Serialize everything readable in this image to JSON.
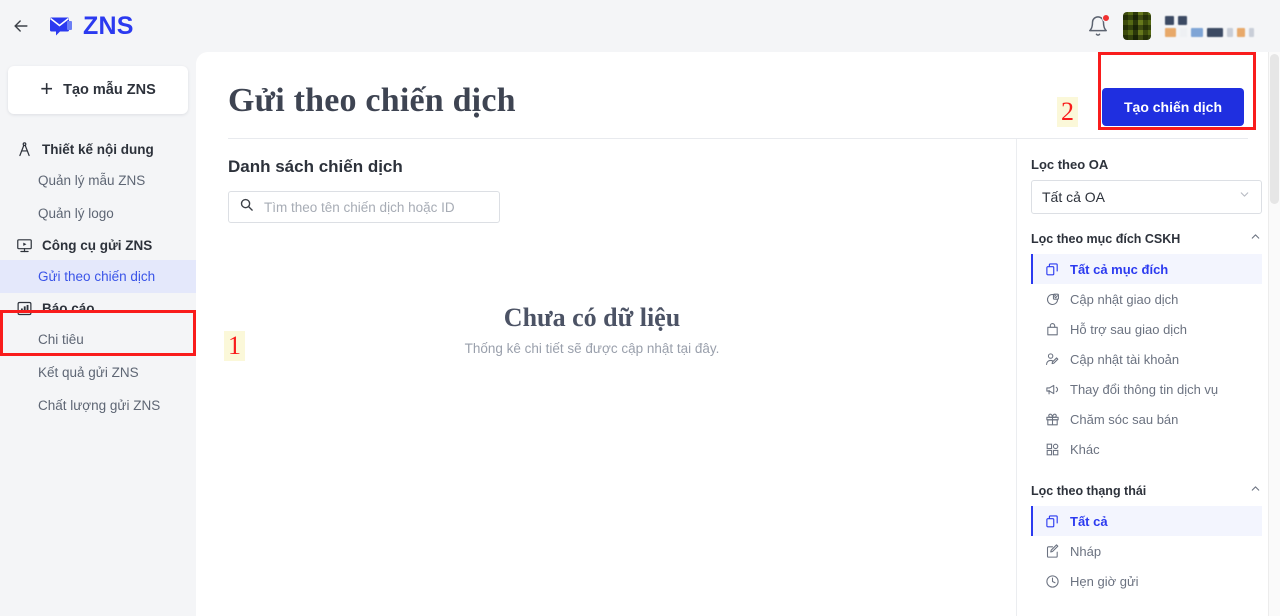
{
  "header": {
    "back_icon": "arrow-left-icon",
    "logo_icon": "envelope-message-icon",
    "brand": "ZNS",
    "bell_icon": "bell-icon",
    "avatar": "user-avatar"
  },
  "sidebar": {
    "create_button": {
      "icon": "plus-icon",
      "label": "Tạo mẫu ZNS"
    },
    "groups": [
      {
        "icon": "compass-design-icon",
        "label": "Thiết kế nội dung",
        "items": [
          {
            "label": "Quản lý mẫu ZNS",
            "active": false
          },
          {
            "label": "Quản lý logo",
            "active": false
          }
        ]
      },
      {
        "icon": "monitor-send-icon",
        "label": "Công cụ gửi ZNS",
        "items": [
          {
            "label": "Gửi theo chiến dịch",
            "active": true
          }
        ]
      },
      {
        "icon": "report-chart-icon",
        "label": "Báo cáo",
        "items": [
          {
            "label": "Chi tiêu",
            "active": false
          },
          {
            "label": "Kết quả gửi ZNS",
            "active": false
          },
          {
            "label": "Chất lượng gửi ZNS",
            "active": false
          }
        ]
      }
    ]
  },
  "main": {
    "page_title": "Gửi theo chiến dịch",
    "primary_button": "Tạo chiến dịch",
    "section_title": "Danh sách chiến dịch",
    "search": {
      "icon": "search-icon",
      "placeholder": "Tìm theo tên chiến dịch hoặc ID",
      "value": ""
    },
    "empty_state": {
      "title": "Chưa có dữ liệu",
      "subtitle": "Thống kê chi tiết sẽ được cập nhật tại đây."
    }
  },
  "filters": {
    "oa": {
      "label": "Lọc theo OA",
      "selected": "Tất cả OA",
      "chevron": "chevron-down-icon"
    },
    "purpose": {
      "label": "Lọc theo mục đích CSKH",
      "caret": "chevron-up-icon",
      "items": [
        {
          "label": "Tất cả mục đích",
          "icon": "layers-icon",
          "active": true
        },
        {
          "label": "Cập nhật giao dịch",
          "icon": "transaction-check-icon",
          "active": false
        },
        {
          "label": "Hỗ trợ sau giao dịch",
          "icon": "bag-icon",
          "active": false
        },
        {
          "label": "Cập nhật tài khoản",
          "icon": "user-edit-icon",
          "active": false
        },
        {
          "label": "Thay đổi thông tin dịch vụ",
          "icon": "megaphone-icon",
          "active": false
        },
        {
          "label": "Chăm sóc sau bán",
          "icon": "gift-icon",
          "active": false
        },
        {
          "label": "Khác",
          "icon": "grid-icon",
          "active": false
        }
      ]
    },
    "status": {
      "label": "Lọc theo thạng thái",
      "caret": "chevron-up-icon",
      "items": [
        {
          "label": "Tất cả",
          "icon": "layers-icon",
          "active": true
        },
        {
          "label": "Nháp",
          "icon": "draft-edit-icon",
          "active": false
        },
        {
          "label": "Hẹn giờ gửi",
          "icon": "clock-icon",
          "active": false
        }
      ]
    }
  },
  "annotations": [
    {
      "number": "1"
    },
    {
      "number": "2"
    }
  ],
  "colors": {
    "brand_blue": "#2b3af0",
    "button_blue": "#1f2fe0",
    "annotation_red": "#f91c1c",
    "annotation_highlight": "#fbf8d9",
    "active_bg": "#e4e8fb"
  }
}
